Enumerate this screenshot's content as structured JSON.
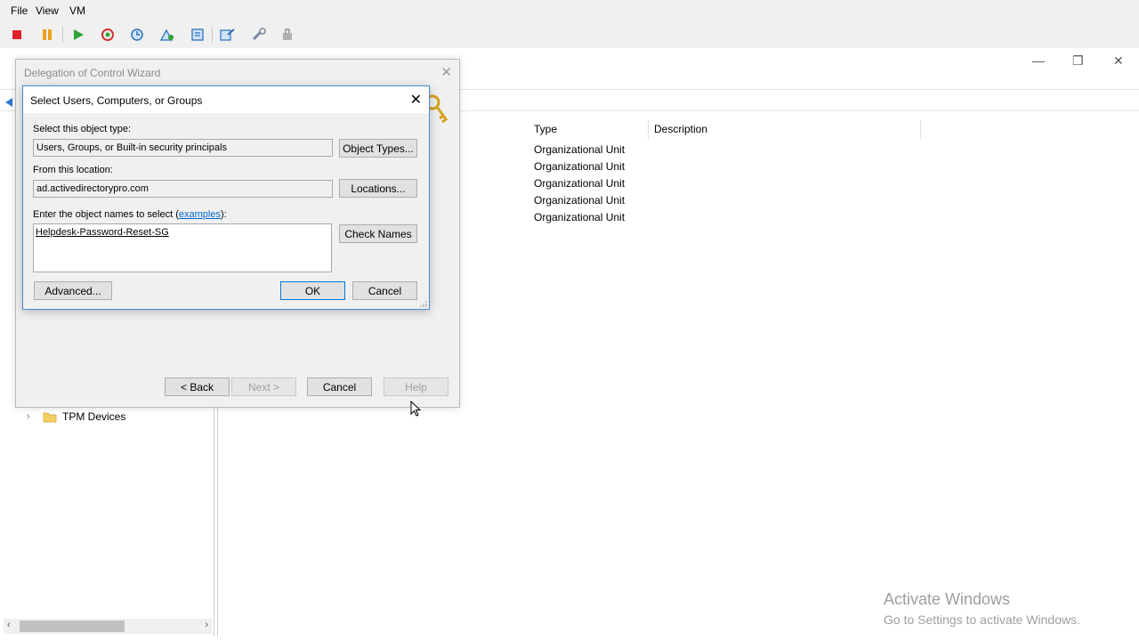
{
  "vm_menu": {
    "file": "File",
    "view": "View",
    "vm": "VM"
  },
  "aduc": {
    "columns": {
      "type": "Type",
      "description": "Description"
    },
    "rows": [
      "Organizational Unit",
      "Organizational Unit",
      "Organizational Unit",
      "Organizational Unit",
      "Organizational Unit"
    ],
    "tree_item_tpm": "TPM Devices"
  },
  "wizard": {
    "title": "Delegation of Control Wizard",
    "back": "< Back",
    "next": "Next >",
    "cancel": "Cancel",
    "help": "Help"
  },
  "select_dialog": {
    "title": "Select Users, Computers, or Groups",
    "object_type_label": "Select this object type:",
    "object_type_value": "Users, Groups, or Built-in security principals",
    "object_types_button": "Object Types...",
    "location_label": "From this location:",
    "location_value": "ad.activedirectorypro.com",
    "locations_button": "Locations...",
    "names_label_prefix": "Enter the object names to select (",
    "names_label_link": "examples",
    "names_label_suffix": "):",
    "names_value": "Helpdesk-Password-Reset-SG",
    "check_names_button": "Check Names",
    "advanced_button": "Advanced...",
    "ok_button": "OK",
    "cancel_button": "Cancel"
  },
  "watermark": {
    "title": "Activate Windows",
    "subtitle": "Go to Settings to activate Windows."
  },
  "colors": {
    "accent": "#0078d7",
    "link": "#0066cc"
  }
}
